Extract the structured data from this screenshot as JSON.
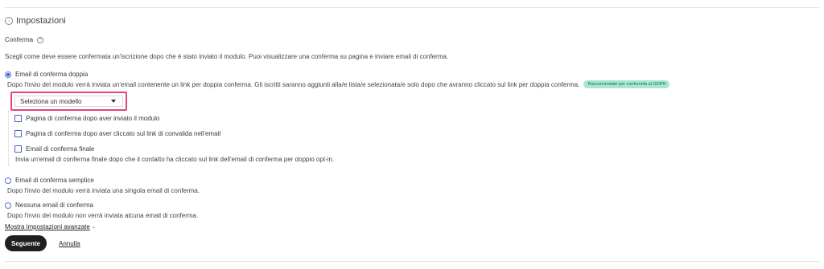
{
  "section": {
    "title": "Impostazioni",
    "conferma_label": "Conferma",
    "description": "Scegli come deve essere confermata un'iscrizione dopo che è stato inviato il modulo. Puoi visualizzare una conferma su pagina e inviare email di conferma."
  },
  "double_optin": {
    "label": "Email di conferma doppia",
    "selected": true,
    "description": "Dopo l'invio del modulo verrà inviata un'email contenente un link per doppia conferma. Gli iscritti saranno aggiunti alla/e lista/e selezionata/e solo dopo che avranno cliccato sul link per doppia conferma.",
    "badge": "Raccomandato per conformità al GDPR",
    "select": {
      "value": "Seleziona un modello"
    },
    "checkboxes": [
      {
        "label": "Pagina di conferma dopo aver inviato il modulo",
        "checked": false
      },
      {
        "label": "Pagina di conferma dopo aver cliccato sul link di convalida nell'email",
        "checked": false
      },
      {
        "label": "Email di conferma finale",
        "checked": false
      }
    ],
    "final_description": "Invia un'email di conferma finale dopo che il contatto ha cliccato sul link dell'email di conferma per doppio opt-in."
  },
  "single_optin": {
    "label": "Email di conferma semplice",
    "selected": false,
    "description": "Dopo l'invio del modulo verrà inviata una singola email di conferma."
  },
  "no_email": {
    "label": "Nessuna email di conferma",
    "selected": false,
    "description": "Dopo l'invio del modulo non verrà inviata alcuna email di conferma."
  },
  "advanced_link": "Mostra impostazioni avanzate",
  "buttons": {
    "next": "Seguente",
    "cancel": "Annulla"
  },
  "colors": {
    "accent": "#3b5bdb",
    "highlight": "#e8447a",
    "badge_bg": "#a7e7d4",
    "primary_button": "#1f1f1f"
  }
}
